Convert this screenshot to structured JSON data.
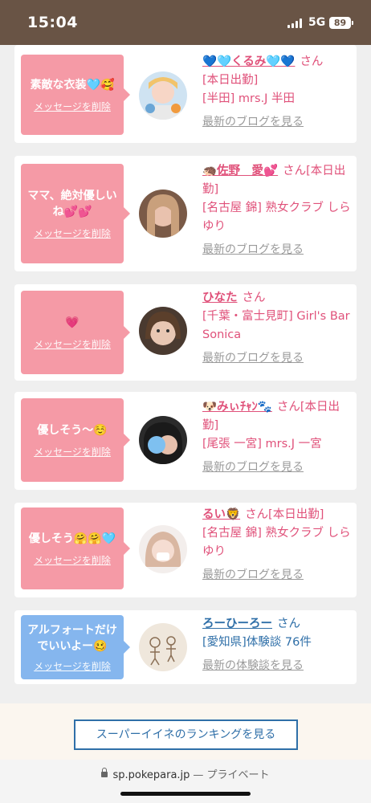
{
  "status_bar": {
    "time": "15:04",
    "network": "5G",
    "battery": "89"
  },
  "cards": [
    {
      "message": "素敵な衣装🩵🥰",
      "delete_label": "メッセージを削除",
      "name": "💙🩵くるみ🩵💙",
      "san": "さん",
      "shop": "[本日出勤]\n[半田] mrs.J 半田",
      "blog": "最新のブログを見る"
    },
    {
      "message": "ママ、絶対優しいね💕💕",
      "delete_label": "メッセージを削除",
      "name": "🦔佐野　愛💕",
      "san": "さん[本日出勤]",
      "shop": "[名古屋 錦] 熟女クラブ しらゆり",
      "blog": "最新のブログを見る"
    },
    {
      "message": "💗",
      "delete_label": "メッセージを削除",
      "name": "ひなた",
      "san": "さん",
      "shop": "[千葉・富士見町] Girl's Bar Sonica",
      "blog": "最新のブログを見る"
    },
    {
      "message": "優しそう〜☺️",
      "delete_label": "メッセージを削除",
      "name": "🐶みぃﾁｬﾝ🐾",
      "san": "さん[本日出勤]",
      "shop": "[尾張 一宮] mrs.J 一宮",
      "blog": "最新のブログを見る"
    },
    {
      "message": "優しそう🤗🤗🩵",
      "delete_label": "メッセージを削除",
      "name": "るい🦁",
      "san": "さん[本日出勤]",
      "shop": "[名古屋 錦] 熟女クラブ しらゆり",
      "blog": "最新のブログを見る"
    },
    {
      "message": "アルフォートだけでいいよー🥴",
      "delete_label": "メッセージを削除",
      "name": "ろーひーろー",
      "san": "さん",
      "shop": "[愛知県]体験談 76件",
      "blog": "最新の体験談を見る"
    }
  ],
  "footer": {
    "ranking_button": "スーパーイイネのランキングを見る"
  },
  "browser": {
    "url": "sp.pokepara.jp",
    "private": "— プライベート"
  },
  "colors": {
    "pink_bubble": "#f59aa6",
    "blue_bubble": "#85b6ee",
    "pink_text": "#e0517a",
    "blue_text": "#2f6fa8",
    "status_bg": "#695445"
  }
}
